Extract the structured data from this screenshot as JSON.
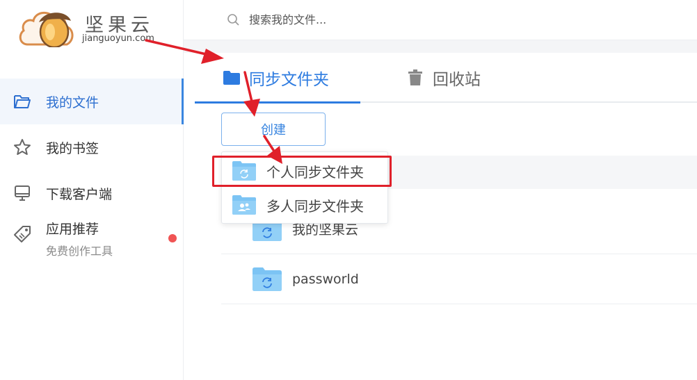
{
  "brand": {
    "name": "坚果云",
    "domain": "jianguoyun.com"
  },
  "sidebar": {
    "items": [
      {
        "label": "我的文件",
        "icon": "folder-open-icon",
        "active": true
      },
      {
        "label": "我的书签",
        "icon": "star-icon"
      },
      {
        "label": "下载客户端",
        "icon": "monitor-icon"
      },
      {
        "label": "应用推荐",
        "sub": "免费创作工具",
        "icon": "tag-icon",
        "badge": "red-dot"
      }
    ]
  },
  "search": {
    "placeholder": "搜索我的文件..."
  },
  "tabs": [
    {
      "label": "同步文件夹",
      "icon": "folder-icon",
      "active": true
    },
    {
      "label": "回收站",
      "icon": "trash-icon"
    }
  ],
  "toolbar": {
    "create_label": "创建"
  },
  "dropdown": {
    "items": [
      {
        "label": "个人同步文件夹",
        "icon": "sync-folder-icon",
        "highlighted": true
      },
      {
        "label": "多人同步文件夹",
        "icon": "shared-folder-icon"
      }
    ]
  },
  "files": [
    {
      "name": "我的坚果云",
      "icon": "sync-folder-icon"
    },
    {
      "name": "passworld",
      "icon": "sync-folder-icon"
    }
  ],
  "colors": {
    "accent": "#2d7be0",
    "annotation": "#e0202a",
    "folder": "#7cc4f4"
  }
}
